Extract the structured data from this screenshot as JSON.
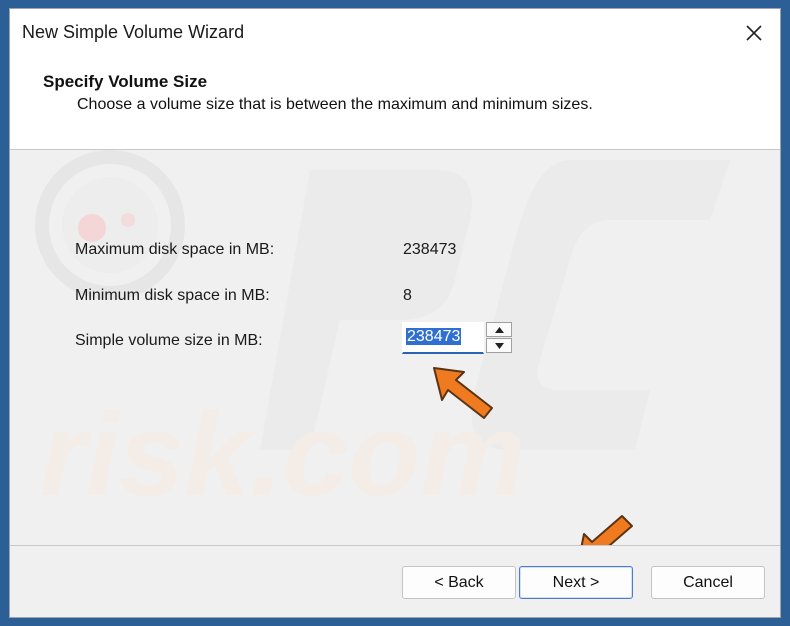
{
  "window": {
    "title": "New Simple Volume Wizard",
    "close_icon": "close-icon"
  },
  "header": {
    "title": "Specify Volume Size",
    "subtitle": "Choose a volume size that is between the maximum and minimum sizes."
  },
  "fields": {
    "max_label": "Maximum disk space in MB:",
    "max_value": "238473",
    "min_label": "Minimum disk space in MB:",
    "min_value": "8",
    "size_label": "Simple volume size in MB:",
    "size_value": "238473"
  },
  "buttons": {
    "back": "< Back",
    "next": "Next >",
    "cancel": "Cancel"
  },
  "watermark": {
    "text": "risk.com"
  },
  "colors": {
    "desktop": "#2b5f95",
    "selection": "#2f6fd1",
    "annotation_arrow": "#f07a1f"
  }
}
